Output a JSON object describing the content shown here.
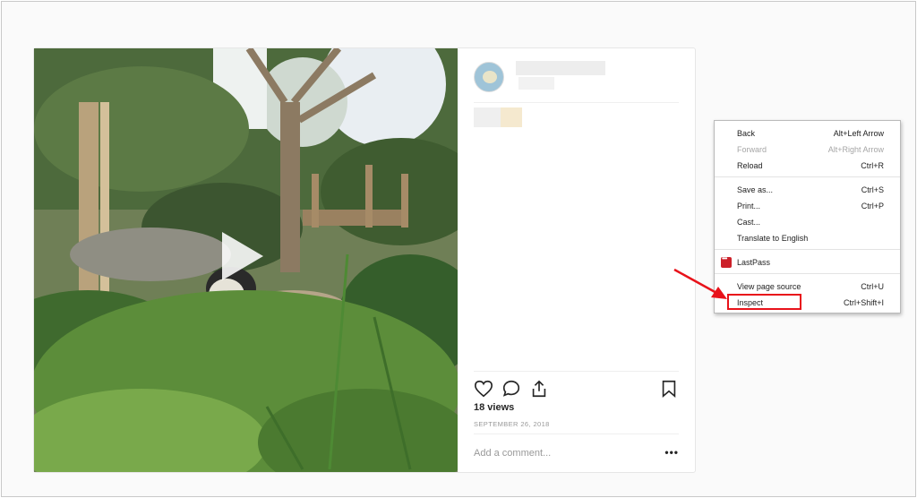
{
  "post": {
    "views": "18 views",
    "date": "SEPTEMBER 26, 2018",
    "comment_placeholder": "Add a comment...",
    "more": "•••",
    "icons": [
      "heart-icon",
      "comment-icon",
      "share-icon",
      "bookmark-icon",
      "play-icon"
    ]
  },
  "context_menu": {
    "items": [
      {
        "label": "Back",
        "shortcut": "Alt+Left Arrow",
        "disabled": false
      },
      {
        "label": "Forward",
        "shortcut": "Alt+Right Arrow",
        "disabled": true
      },
      {
        "label": "Reload",
        "shortcut": "Ctrl+R",
        "disabled": false
      },
      {
        "label": "Save as...",
        "shortcut": "Ctrl+S",
        "disabled": false
      },
      {
        "label": "Print...",
        "shortcut": "Ctrl+P",
        "disabled": false
      },
      {
        "label": "Cast...",
        "shortcut": "",
        "disabled": false
      },
      {
        "label": "Translate to English",
        "shortcut": "",
        "disabled": false
      },
      {
        "label": "LastPass",
        "shortcut": "",
        "disabled": false
      },
      {
        "label": "View page source",
        "shortcut": "Ctrl+U",
        "disabled": false
      },
      {
        "label": "Inspect",
        "shortcut": "Ctrl+Shift+I",
        "disabled": false
      }
    ]
  },
  "colors": {
    "highlight": "#e8121a",
    "lastpass": "#cc2029"
  }
}
